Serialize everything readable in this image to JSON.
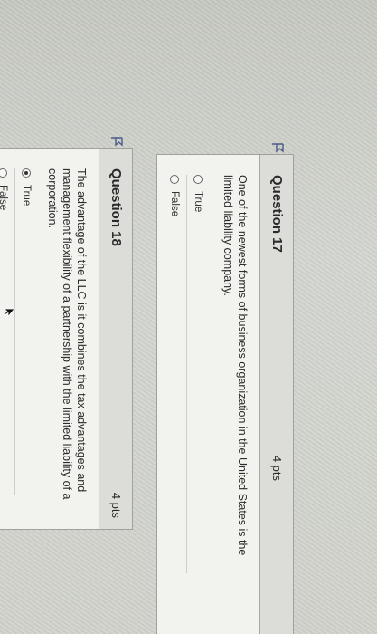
{
  "questions": [
    {
      "title": "Question 17",
      "points": "4 pts",
      "text_lines": [
        "One of the newest forms of business organization in the United States is the",
        "limited liability company."
      ],
      "options": [
        {
          "label": "True",
          "selected": false
        },
        {
          "label": "False",
          "selected": false
        }
      ]
    },
    {
      "title": "Question 18",
      "points": "4 pts",
      "text_lines": [
        "The advantage of the LLC is it combines the tax advantages and",
        "management flexibility of a partnership with the limited liability of a",
        "corporation."
      ],
      "options": [
        {
          "label": "True",
          "selected": true
        },
        {
          "label": "False",
          "selected": false
        }
      ]
    }
  ],
  "icons": {
    "flag": "flag-icon",
    "cursor": "mouse-pointer-icon"
  },
  "colors": {
    "card_bg": "#f2f2ef",
    "header_bg": "#dcdcd8"
  }
}
